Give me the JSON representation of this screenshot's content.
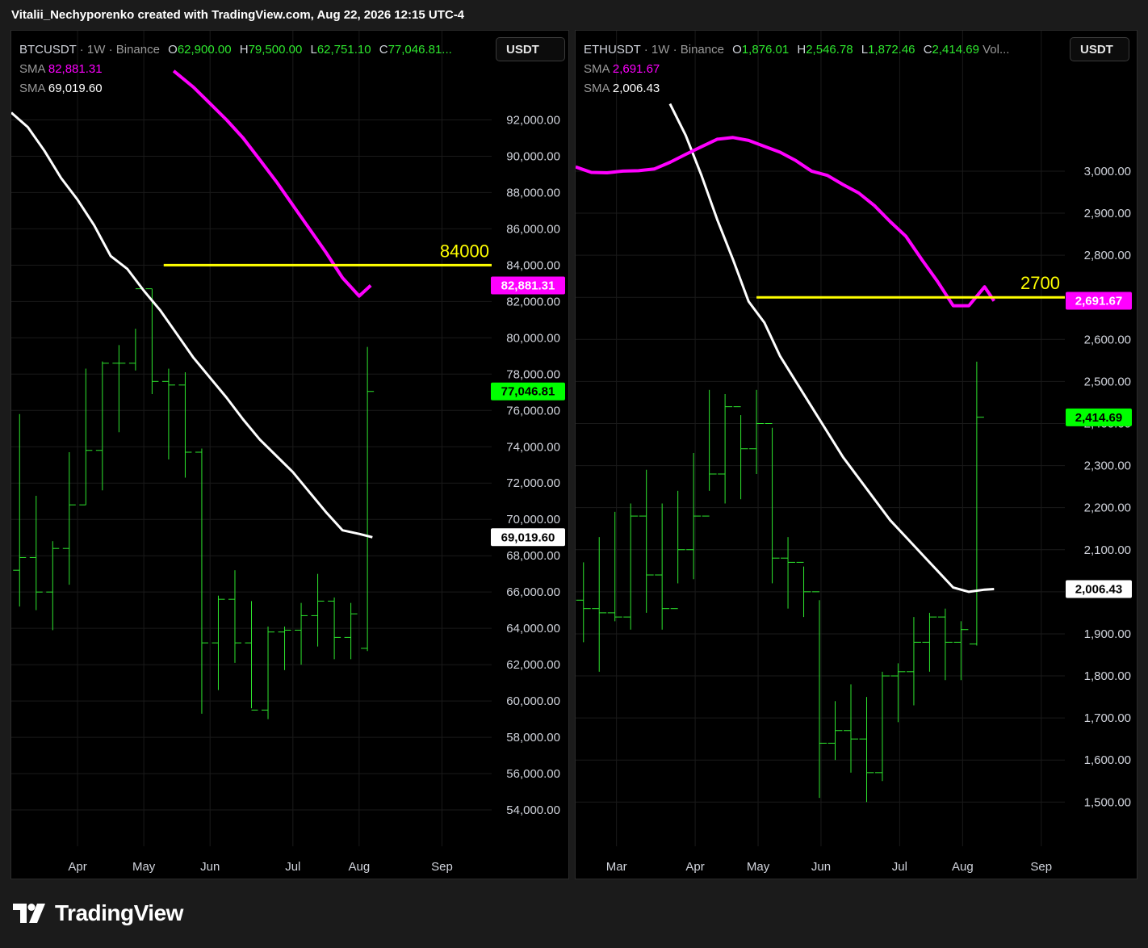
{
  "caption": "Vitalii_Nechyporenko created with TradingView.com, Aug 22, 2026 12:15 UTC-4",
  "brand": {
    "logo_text": "TradingView"
  },
  "colors": {
    "bar_up": "#2ee62e",
    "sma_fast": "#ff00ff",
    "sma_slow": "#ffffff",
    "level_line": "#ffff00",
    "price_tag": "#00ff00",
    "background": "#000000"
  },
  "chart_data": [
    {
      "type": "ohlc",
      "symbol": "BTCUSDT",
      "interval": "1W",
      "exchange": "Binance",
      "currency": "USDT",
      "legend": {
        "O": "62,900.00",
        "H": "79,500.00",
        "L": "62,751.10",
        "C": "77,046.81..."
      },
      "indicators": [
        {
          "name": "SMA",
          "value": "82,881.31",
          "color": "#ff00ff"
        },
        {
          "name": "SMA",
          "value": "69,019.60",
          "color": "#ffffff"
        }
      ],
      "ylim": [
        52000,
        94200
      ],
      "yticks": [
        "92,000.00",
        "90,000.00",
        "88,000.00",
        "86,000.00",
        "84,000.00",
        "82,000.00",
        "80,000.00",
        "78,000.00",
        "76,000.00",
        "74,000.00",
        "72,000.00",
        "70,000.00",
        "68,000.00",
        "66,000.00",
        "64,000.00",
        "62,000.00",
        "60,000.00",
        "58,000.00",
        "56,000.00",
        "54,000.00"
      ],
      "xticks": [
        {
          "label": "Apr",
          "index": 3.5
        },
        {
          "label": "May",
          "index": 7.5
        },
        {
          "label": "Jun",
          "index": 11.5
        },
        {
          "label": "Jul",
          "index": 16.5
        },
        {
          "label": "Aug",
          "index": 20.5
        },
        {
          "label": "Sep",
          "index": 25.5
        }
      ],
      "xlim": [
        -0.5,
        28.5
      ],
      "bars": [
        [
          67200,
          75800,
          65200,
          67900
        ],
        [
          67900,
          71300,
          65000,
          66000
        ],
        [
          66000,
          68800,
          63900,
          68400
        ],
        [
          68400,
          73700,
          66400,
          70800
        ],
        [
          70800,
          78300,
          70800,
          73800
        ],
        [
          73800,
          78700,
          71600,
          78600
        ],
        [
          78600,
          79600,
          74800,
          78600
        ],
        [
          78600,
          80500,
          78200,
          82700
        ],
        [
          82700,
          82700,
          76900,
          77600
        ],
        [
          77600,
          78300,
          73300,
          77400
        ],
        [
          77400,
          78100,
          72300,
          73700
        ],
        [
          73700,
          73900,
          59300,
          63200
        ],
        [
          63200,
          65800,
          60600,
          65600
        ],
        [
          65600,
          67200,
          62100,
          63200
        ],
        [
          63200,
          65500,
          59600,
          59500
        ],
        [
          59500,
          64100,
          59000,
          63800
        ],
        [
          63800,
          64100,
          61700,
          63900
        ],
        [
          63900,
          65400,
          62000,
          64700
        ],
        [
          64700,
          67000,
          63000,
          65500
        ],
        [
          65500,
          65700,
          62300,
          63500
        ],
        [
          63500,
          65400,
          62300,
          64800
        ],
        [
          62900,
          79500,
          62751,
          77047
        ]
      ],
      "sma_fast": {
        "x": [
          9.3,
          10.5,
          11.5,
          12.5,
          13.5,
          14.5,
          15.5,
          16.5,
          17.5,
          18.5,
          19.5,
          20.5,
          21.2
        ],
        "y": [
          94700,
          93800,
          92900,
          92000,
          91000,
          89800,
          88600,
          87300,
          86000,
          84700,
          83300,
          82300,
          82881
        ]
      },
      "sma_slow": {
        "x": [
          -0.5,
          0.5,
          1.5,
          2.5,
          3.5,
          4.5,
          5.5,
          6.5,
          7.5,
          8.5,
          9.5,
          10.5,
          11.5,
          12.5,
          13.5,
          14.5,
          15.5,
          16.5,
          17.5,
          18.5,
          19.5,
          20.5,
          21.3
        ],
        "y": [
          92400,
          91600,
          90300,
          88800,
          87600,
          86200,
          84500,
          83800,
          82600,
          81500,
          80200,
          78900,
          77800,
          76700,
          75500,
          74400,
          73500,
          72600,
          71500,
          70400,
          69400,
          69200,
          69020
        ]
      },
      "level": {
        "value": 84000,
        "label": "84000",
        "from": 8.7,
        "to": 28.5
      },
      "price_tags": [
        {
          "value": 82881.31,
          "text": "82,881.31",
          "bg": "#ff00ff",
          "fg": "#ffffff"
        },
        {
          "value": 77046.81,
          "text": "77,046.81",
          "bg": "#00ff00",
          "fg": "#000000"
        },
        {
          "value": 69019.6,
          "text": "69,019.60",
          "bg": "#ffffff",
          "fg": "#000000"
        }
      ]
    },
    {
      "type": "ohlc",
      "symbol": "ETHUSDT",
      "interval": "1W",
      "exchange": "Binance",
      "currency": "USDT",
      "legend": {
        "O": "1,876.01",
        "H": "2,546.78",
        "L": "1,872.46",
        "C": "2,414.69",
        "extra": "Vol..."
      },
      "indicators": [
        {
          "name": "SMA",
          "value": "2,691.67",
          "color": "#ff00ff"
        },
        {
          "name": "SMA",
          "value": "2,006.43",
          "color": "#ffffff"
        }
      ],
      "ylim": [
        1395,
        3165
      ],
      "yticks": [
        "3,000.00",
        "2,900.00",
        "2,800.00",
        "2,700.00",
        "2,600.00",
        "2,500.00",
        "2,400.00",
        "2,300.00",
        "2,200.00",
        "2,100.00",
        "2,000.00",
        "1,900.00",
        "1,800.00",
        "1,700.00",
        "1,600.00",
        "1,500.00"
      ],
      "xticks": [
        {
          "label": "Mar",
          "index": 2.1
        },
        {
          "label": "Apr",
          "index": 7.1
        },
        {
          "label": "May",
          "index": 11.1
        },
        {
          "label": "Jun",
          "index": 15.1
        },
        {
          "label": "Jul",
          "index": 20.1
        },
        {
          "label": "Aug",
          "index": 24.1
        },
        {
          "label": "Sep",
          "index": 29.1
        }
      ],
      "xlim": [
        -0.5,
        30.6
      ],
      "bars": [
        [
          1980,
          2070,
          1880,
          1960
        ],
        [
          1960,
          2130,
          1810,
          1950
        ],
        [
          1950,
          2190,
          1930,
          1940
        ],
        [
          1940,
          2210,
          1910,
          2180
        ],
        [
          2180,
          2290,
          1950,
          2040
        ],
        [
          2040,
          2210,
          1910,
          1960
        ],
        [
          1960,
          2240,
          2020,
          2100
        ],
        [
          2100,
          2330,
          2030,
          2180
        ],
        [
          2180,
          2480,
          2240,
          2280
        ],
        [
          2280,
          2470,
          2210,
          2440
        ],
        [
          2440,
          2420,
          2220,
          2340
        ],
        [
          2340,
          2480,
          2280,
          2400
        ],
        [
          2400,
          2390,
          2020,
          2080
        ],
        [
          2080,
          2130,
          1960,
          2070
        ],
        [
          2070,
          2060,
          1940,
          2000
        ],
        [
          2000,
          1980,
          1510,
          1640
        ],
        [
          1640,
          1740,
          1600,
          1670
        ],
        [
          1670,
          1780,
          1570,
          1650
        ],
        [
          1650,
          1750,
          1500,
          1570
        ],
        [
          1570,
          1810,
          1550,
          1800
        ],
        [
          1800,
          1830,
          1690,
          1810
        ],
        [
          1810,
          1940,
          1730,
          1880
        ],
        [
          1880,
          1950,
          1810,
          1940
        ],
        [
          1940,
          1960,
          1790,
          1880
        ],
        [
          1880,
          1930,
          1790,
          1910
        ],
        [
          1876,
          2547,
          1872,
          2415
        ]
      ],
      "sma_fast": {
        "x": [
          -0.5,
          0.5,
          1.5,
          2.5,
          3.5,
          4.5,
          5.5,
          6.5,
          7.5,
          8.5,
          9.5,
          10.5,
          11.5,
          12.5,
          13.5,
          14.5,
          15.5,
          16.5,
          17.5,
          18.5,
          19.5,
          20.5,
          21.5,
          22.5,
          23.5,
          24.5,
          25.5,
          26.1
        ],
        "y": [
          3010,
          2997,
          2996,
          3000,
          3001,
          3005,
          3021,
          3040,
          3058,
          3076,
          3080,
          3073,
          3059,
          3045,
          3025,
          3000,
          2990,
          2968,
          2948,
          2918,
          2880,
          2845,
          2790,
          2738,
          2680,
          2680,
          2725,
          2691.67
        ]
      },
      "sma_slow": {
        "x": [
          5.5,
          6.5,
          7.5,
          8.5,
          9.5,
          10.5,
          11.5,
          12.5,
          13.5,
          14.5,
          15.5,
          16.5,
          17.5,
          18.5,
          19.5,
          20.5,
          21.5,
          22.5,
          23.5,
          24.5,
          25.5,
          26.1
        ],
        "y": [
          3160,
          3085,
          2990,
          2885,
          2790,
          2690,
          2640,
          2560,
          2500,
          2440,
          2380,
          2320,
          2270,
          2220,
          2170,
          2130,
          2090,
          2050,
          2010,
          2000,
          2005,
          2006.43
        ]
      },
      "level": {
        "value": 2700,
        "label": "2700",
        "from": 11.0,
        "to": 30.6
      },
      "price_tags": [
        {
          "value": 2691.67,
          "text": "2,691.67",
          "bg": "#ff00ff",
          "fg": "#ffffff"
        },
        {
          "value": 2414.69,
          "text": "2,414.69",
          "bg": "#00ff00",
          "fg": "#000000"
        },
        {
          "value": 2006.43,
          "text": "2,006.43",
          "bg": "#ffffff",
          "fg": "#000000"
        }
      ]
    }
  ]
}
